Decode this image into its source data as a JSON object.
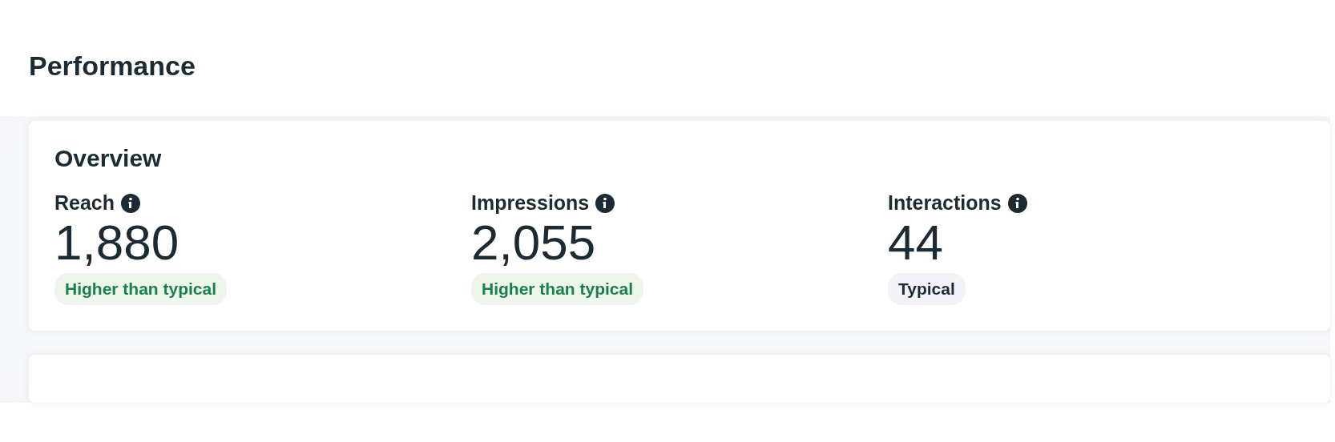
{
  "page": {
    "title": "Performance"
  },
  "overview": {
    "title": "Overview",
    "metrics": [
      {
        "label": "Reach",
        "value": "1,880",
        "badge": {
          "text": "Higher than typical",
          "kind": "higher"
        }
      },
      {
        "label": "Impressions",
        "value": "2,055",
        "badge": {
          "text": "Higher than typical",
          "kind": "higher"
        }
      },
      {
        "label": "Interactions",
        "value": "44",
        "badge": {
          "text": "Typical",
          "kind": "typical"
        }
      }
    ]
  }
}
